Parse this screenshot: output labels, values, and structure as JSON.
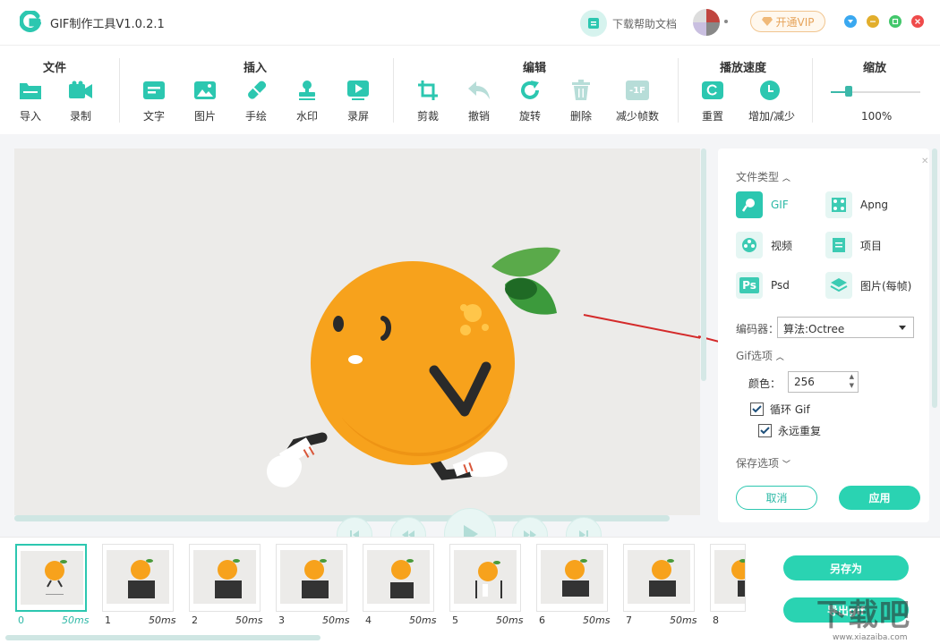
{
  "app": {
    "title": "GIF制作工具V1.0.2.1",
    "help_text": "下载帮助文档",
    "vip_label": "开通VIP"
  },
  "colors": {
    "accent": "#2cc7b0",
    "button": "#2ad3b2"
  },
  "toolbar": {
    "groups": {
      "file": "文件",
      "insert": "插入",
      "edit": "编辑",
      "speed": "播放速度",
      "zoom": "缩放"
    },
    "tools": {
      "import": "导入",
      "record": "录制",
      "text": "文字",
      "image": "图片",
      "draw": "手绘",
      "watermark": "水印",
      "screen_record": "录屏",
      "crop": "剪裁",
      "undo": "撤销",
      "rotate": "旋转",
      "delete": "删除",
      "reduce_frames": "减少帧数",
      "reset": "重置",
      "increase_decrease": "增加/减少"
    },
    "reduce_frames_badge": "-1F",
    "zoom_value": "100%",
    "zoom_level": 0.2
  },
  "panel": {
    "file_type_title": "文件类型",
    "file_types": {
      "gif": "GIF",
      "apng": "Apng",
      "video": "视频",
      "project": "项目",
      "psd": "Psd",
      "image_per_frame": "图片(每帧)"
    },
    "psd_badge": "Ps",
    "encoder_label": "编码器：",
    "encoder_value": "算法:Octree",
    "gif_options_title": "Gif选项",
    "color_label": "颜色：",
    "color_value": "256",
    "loop_gif": "循环 Gif",
    "loop_gif_checked": true,
    "repeat_forever": "永远重复",
    "repeat_forever_checked": true,
    "save_options_title": "保存选项",
    "cancel": "取消",
    "apply": "应用"
  },
  "frames": [
    {
      "index": "0",
      "duration": "50ms"
    },
    {
      "index": "1",
      "duration": "50ms"
    },
    {
      "index": "2",
      "duration": "50ms"
    },
    {
      "index": "3",
      "duration": "50ms"
    },
    {
      "index": "4",
      "duration": "50ms"
    },
    {
      "index": "5",
      "duration": "50ms"
    },
    {
      "index": "6",
      "duration": "50ms"
    },
    {
      "index": "7",
      "duration": "50ms"
    },
    {
      "index": "8",
      "duration": ""
    }
  ],
  "actions": {
    "save_as": "另存为",
    "export_gif": "导出gif"
  },
  "watermark": {
    "text": "下载吧",
    "url": "www.xiazaiba.com"
  }
}
